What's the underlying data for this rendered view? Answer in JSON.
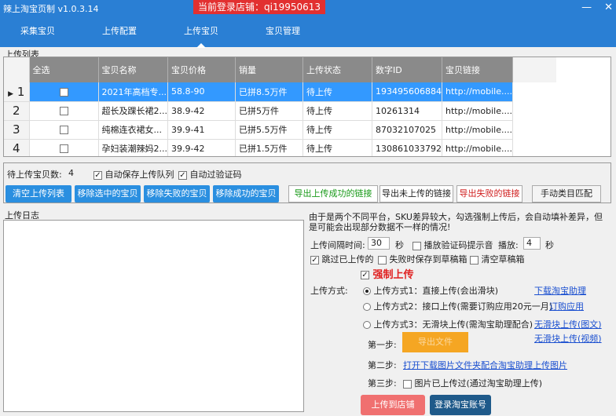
{
  "app": {
    "title": "辣上淘宝页制 v1.0.3.14",
    "store_label": "当前登录店铺：qi19950613",
    "min": "—",
    "close": "✕"
  },
  "nav": {
    "items": [
      "采集宝贝",
      "上传配置",
      "上传宝贝",
      "宝贝管理"
    ],
    "active": 2
  },
  "list": {
    "group_title": "上传列表",
    "columns": [
      "全选",
      "宝贝名称",
      "宝贝价格",
      "销量",
      "上传状态",
      "数字ID",
      "宝贝链接"
    ],
    "rows": [
      {
        "num": "1",
        "checked": false,
        "name": "2021年高档专...",
        "price": "58.8-90",
        "sales": "已拼8.5万件",
        "status": "待上传",
        "id": "193495606884",
        "link": "http://mobile...."
      },
      {
        "num": "2",
        "checked": false,
        "name": "超长及踝长裙2...",
        "price": "38.9-42",
        "sales": "已拼5万件",
        "status": "待上传",
        "id": "10261314",
        "link": "http://mobile...."
      },
      {
        "num": "3",
        "checked": false,
        "name": "纯棉连衣裙女...",
        "price": "39.9-41",
        "sales": "已拼5.5万件",
        "status": "待上传",
        "id": "87032107025",
        "link": "http://mobile...."
      },
      {
        "num": "4",
        "checked": false,
        "name": "孕妇装潮辣妈2...",
        "price": "39.9-42",
        "sales": "已拼1.5万件",
        "status": "待上传",
        "id": "130861033792",
        "link": "http://mobile...."
      }
    ]
  },
  "queue": {
    "count_label": "待上传宝贝数:",
    "count": "4",
    "autosave": "自动保存上传队列",
    "autoverify": "自动过验证码",
    "btn_clear": "清空上传列表",
    "btn_remove_sel": "移除选中的宝贝",
    "btn_remove_fail": "移除失败的宝贝",
    "btn_remove_ok": "移除成功的宝贝",
    "btn_export_ok": "导出上传成功的链接",
    "btn_export_pending": "导出未上传的链接",
    "btn_export_fail": "导出失败的链接",
    "btn_match": "手动类目匹配",
    "color_green": "#1a9a1a",
    "color_red": "#d02020"
  },
  "log": {
    "title": "上传日志"
  },
  "settings": {
    "notice": "由于是两个不同平台，SKU差异较大，勾选强制上传后，会自动填补差异，但是可能会出现部分数据不一样的情况!",
    "interval_label": "上传间隔时间:",
    "interval": "30",
    "sec": "秒",
    "sound_label": "播放验证码提示音",
    "play_label": "播放:",
    "play": "4",
    "sec2": "秒",
    "skip": "跳过已上传的",
    "save_draft": "失败时保存到草稿箱",
    "clear_draft": "清空草稿箱",
    "force": "强制上传",
    "method_label": "上传方式:",
    "m1": "上传方式1：直接上传(会出滑块)",
    "m1_link": "下载淘宝助理",
    "m2": "上传方式2：接口上传(需要订购应用20元一月)",
    "m2_link": "订购应用",
    "m3": "上传方式3：无滑块上传(需淘宝助理配合)",
    "m3_link1": "无滑块上传(图文)",
    "m3_link2": "无滑块上传(视频)",
    "step1": "第一步:",
    "step1_btn": "导出文件",
    "step2": "第二步:",
    "step2_link": "打开下载图片文件夹配合淘宝助理上传图片",
    "step3": "第三步:",
    "step3_cb": "图片已上传过(通过淘宝助理上传)",
    "btn_upload": "上传到店铺",
    "btn_login": "登录淘宝账号"
  }
}
